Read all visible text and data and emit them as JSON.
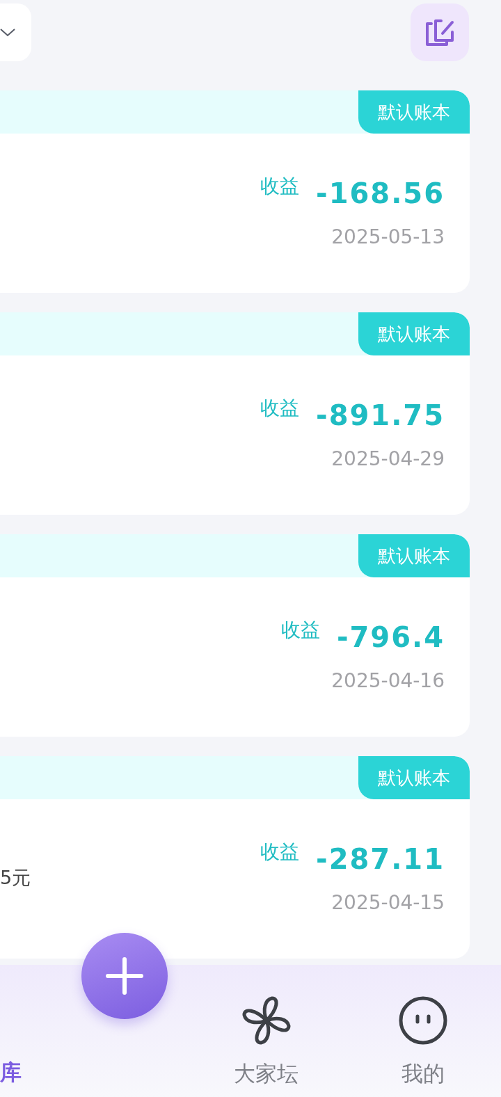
{
  "records": [
    {
      "badge": "默认账本",
      "profit_label": "收益",
      "amount": "-168.56",
      "date": "2025-05-13"
    },
    {
      "badge": "默认账本",
      "profit_label": "收益",
      "amount": "-891.75",
      "date": "2025-04-29"
    },
    {
      "badge": "默认账本",
      "profit_label": "收益",
      "amount": "-796.4",
      "date": "2025-04-16"
    },
    {
      "badge": "默认账本",
      "profit_label": "收益",
      "amount": "-287.11",
      "date": "2025-04-15",
      "note": "5元"
    }
  ],
  "tab_bar": [
    {
      "label": "库",
      "selected": true,
      "kind": "library"
    },
    {
      "kind": "add"
    },
    {
      "label": "大家坛",
      "selected": false,
      "kind": "forum"
    },
    {
      "label": "我的",
      "selected": false,
      "kind": "profile"
    }
  ]
}
